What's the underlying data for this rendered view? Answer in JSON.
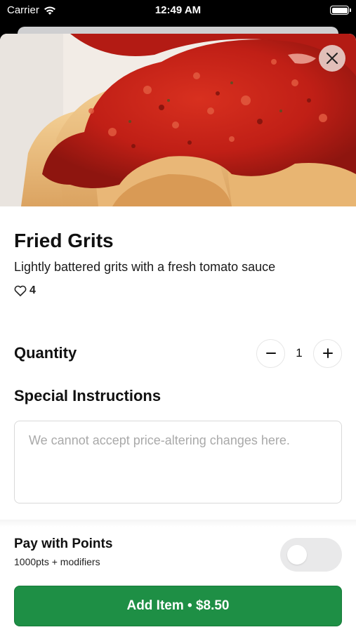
{
  "status_bar": {
    "carrier": "Carrier",
    "time": "12:49 AM"
  },
  "item": {
    "name": "Fried Grits",
    "description": "Lightly battered grits with a fresh tomato sauce",
    "likes": "4"
  },
  "quantity": {
    "label": "Quantity",
    "value": "1"
  },
  "special_instructions": {
    "label": "Special Instructions",
    "placeholder": "We cannot accept price-altering changes here.",
    "value": ""
  },
  "points": {
    "title": "Pay with Points",
    "subtitle": "1000pts + modifiers",
    "enabled": false
  },
  "add_button": {
    "label": "Add Item • $8.50"
  },
  "icons": [
    "wifi-icon",
    "battery-icon",
    "close-icon",
    "heart-outline-icon",
    "minus-icon",
    "plus-icon"
  ],
  "colors": {
    "primary_green": "#1e8f45",
    "sauce_red": "#c8231a",
    "toggle_off": "#e9e9ea"
  }
}
